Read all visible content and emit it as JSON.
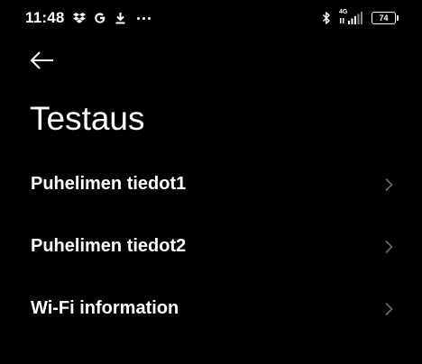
{
  "status_bar": {
    "time": "11:48",
    "network_type": "4G",
    "battery_level": "74",
    "notification_icons": [
      "dropbox-icon",
      "google-icon",
      "download-icon",
      "more-notifications-icon"
    ],
    "system_icons": [
      "bluetooth-icon",
      "signal-icon",
      "battery-icon"
    ]
  },
  "header": {
    "back_icon": "arrow-left-icon",
    "title": "Testaus"
  },
  "menu": {
    "items": [
      {
        "label": "Puhelimen tiedot1",
        "icon": "chevron-right-icon"
      },
      {
        "label": "Puhelimen tiedot2",
        "icon": "chevron-right-icon"
      },
      {
        "label": "Wi-Fi information",
        "icon": "chevron-right-icon"
      }
    ]
  },
  "colors": {
    "background": "#000000",
    "text": "#ffffff",
    "chevron": "#6b6b6b"
  }
}
